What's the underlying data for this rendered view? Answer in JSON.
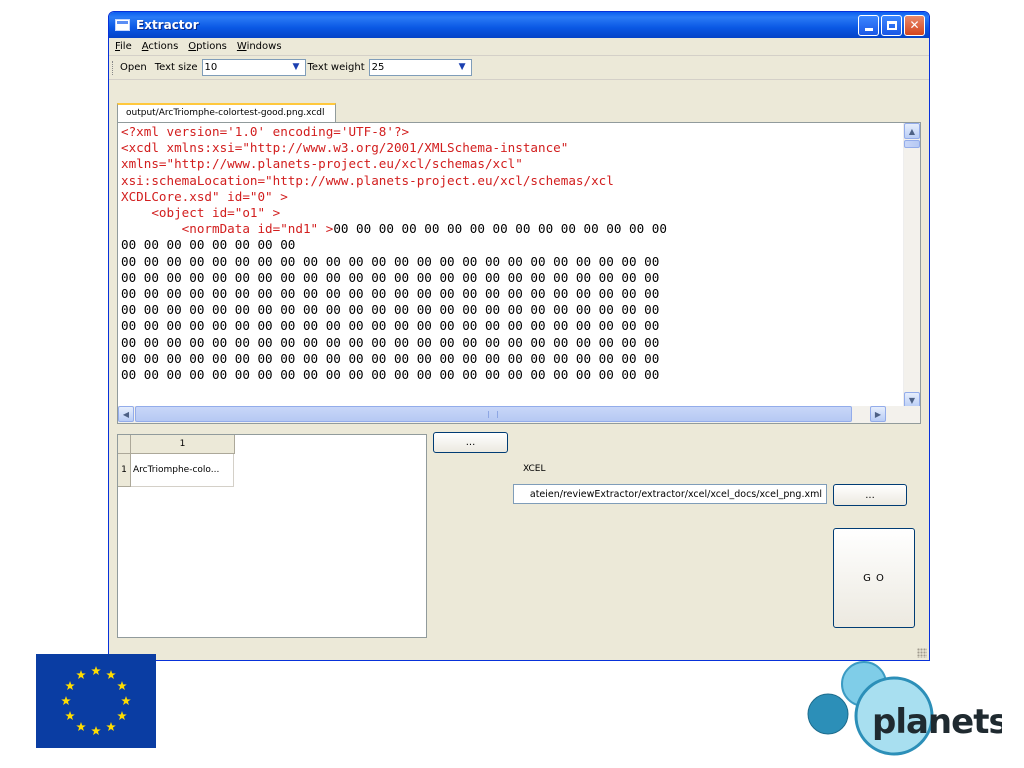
{
  "window": {
    "title": "Extractor"
  },
  "menu": [
    {
      "mnemonic": "F",
      "rest": "ile"
    },
    {
      "mnemonic": "A",
      "rest": "ctions"
    },
    {
      "mnemonic": "O",
      "rest": "ptions"
    },
    {
      "mnemonic": "W",
      "rest": "indows"
    }
  ],
  "toolbar": {
    "open_label": "Open",
    "text_size_label": "Text size",
    "text_size_value": "10",
    "text_weight_label": "Text weight",
    "text_weight_value": "25"
  },
  "editor": {
    "tab_label": "output/ArcTriomphe-colortest-good.png.xcdl",
    "xml_lines": [
      "<?xml version='1.0' encoding='UTF-8'?>",
      "<xcdl xmlns:xsi=\"http://www.w3.org/2001/XMLSchema-instance\"",
      "xmlns=\"http://www.planets-project.eu/xcl/schemas/xcl\"",
      "xsi:schemaLocation=\"http://www.planets-project.eu/xcl/schemas/xcl",
      "XCDLCore.xsd\" id=\"0\" >",
      "    <object id=\"o1\" >",
      "        <normData id=\"nd1\" >"
    ],
    "hex_line_tail": "00 00 00 00 00 00 00 00 00 00 00 00 00 00 00",
    "hex_short_line": "00 00 00 00 00 00 00 00",
    "hex_full_line": "00 00 00 00 00 00 00 00 00 00 00 00 00 00 00 00 00 00 00 00 00 00 00 00",
    "hex_full_line_count": 8
  },
  "files_table": {
    "column_header": "1",
    "row_number": "1",
    "cell_value": "ArcTriomphe-colo..."
  },
  "controls": {
    "browse_label": "...",
    "xcel_label": "XCEL",
    "xcel_path": "ateien/reviewExtractor/extractor/xcel/xcel_docs/xcel_png.xml",
    "xcel_browse_label": "...",
    "go_label": "G O"
  },
  "colors": {
    "titlebar": "#0a58e4",
    "xml_text": "#d21e1e",
    "eu_blue": "#0a3da3",
    "eu_star": "#ffdd00",
    "planets_teal": "#2c8fb8",
    "planets_light": "#a8dff0"
  }
}
